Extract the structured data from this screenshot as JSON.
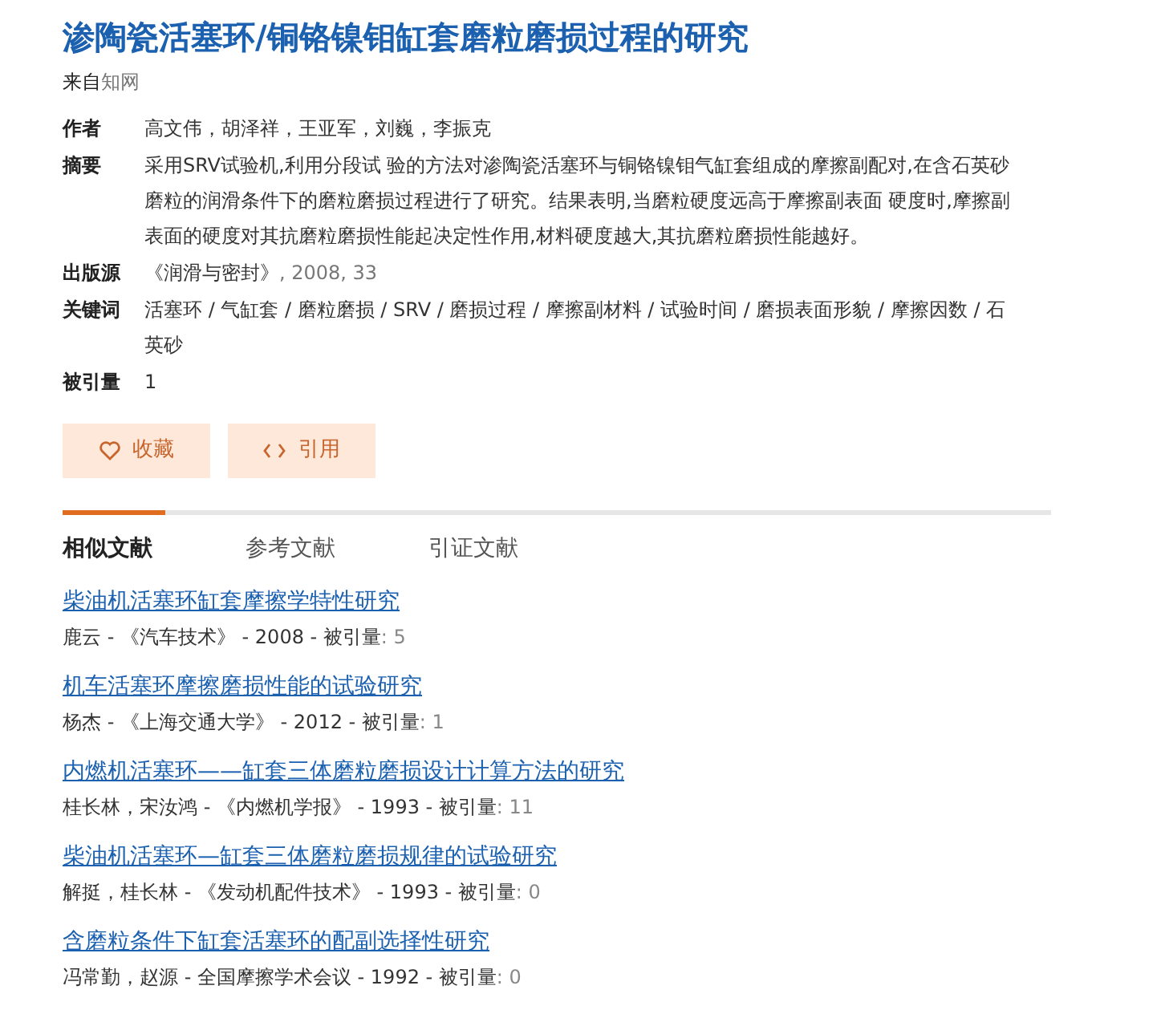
{
  "title": "渗陶瓷活塞环/铜铬镍钼缸套磨粒磨损过程的研究",
  "source": {
    "prefix": "来自",
    "site": "知网"
  },
  "fields": [
    {
      "kind": "text",
      "label": "作者",
      "value": "高文伟，胡泽祥，王亚军，刘巍，李振克"
    },
    {
      "kind": "text",
      "label": "摘要",
      "value": "采用SRV试验机,利用分段试 验的方法对渗陶瓷活塞环与铜铬镍钼气缸套组成的摩擦副配对,在含石英砂磨粒的润滑条件下的磨粒磨损过程进行了研究。结果表明,当磨粒硬度远高于摩擦副表面 硬度时,摩擦副表面的硬度对其抗磨粒磨损性能起决定性作用,材料硬度越大,其抗磨粒磨损性能越好。"
    },
    {
      "kind": "publication",
      "label": "出版源",
      "value": "《润滑与密封》",
      "detail": ", 2008, 33"
    },
    {
      "kind": "text",
      "label": "关键词",
      "value": "活塞环 / 气缸套 / 磨粒磨损 / SRV / 磨损过程 / 摩擦副材料 / 试验时间 / 磨损表面形貌 / 摩擦因数 / 石英砂"
    },
    {
      "kind": "text",
      "label": "被引量",
      "value": "1"
    }
  ],
  "actions": [
    {
      "kind": "favorite",
      "label": "收藏"
    },
    {
      "kind": "cite",
      "label": "引用"
    }
  ],
  "tabs": [
    {
      "label": "相似文献",
      "selected": true
    },
    {
      "label": "参考文献",
      "selected": false
    },
    {
      "label": "引证文献",
      "selected": false
    }
  ],
  "results": [
    {
      "title": "柴油机活塞环缸套摩擦学特性研究",
      "meta": "鹿云 - 《汽车技术》 - 2008 - 被引量",
      "citations": ": 5"
    },
    {
      "title": "机车活塞环摩擦磨损性能的试验研究",
      "meta": "杨杰 - 《上海交通大学》 - 2012 - 被引量",
      "citations": ": 1"
    },
    {
      "title": "内燃机活塞环——缸套三体磨粒磨损设计计算方法的研究",
      "meta": "桂长林，宋汝鸿 - 《内燃机学报》 - 1993 - 被引量",
      "citations": ": 11"
    },
    {
      "title": "柴油机活塞环—缸套三体磨粒磨损规律的试验研究",
      "meta": "解挺，桂长林 - 《发动机配件技术》 - 1993 - 被引量",
      "citations": ": 0"
    },
    {
      "title": "含磨粒条件下缸套活塞环的配副选择性研究",
      "meta": "冯常勤，赵源 - 全国摩擦学术会议 - 1992 - 被引量",
      "citations": ": 0"
    }
  ]
}
